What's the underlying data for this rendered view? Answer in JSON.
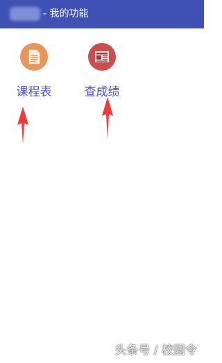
{
  "appbar": {
    "title": "- 我的功能",
    "background": "#3f51b5"
  },
  "features": [
    {
      "label": "课程表",
      "icon": "document-icon",
      "icon_bg": "#e8965a"
    },
    {
      "label": "查成绩",
      "icon": "newspaper-icon",
      "icon_bg": "#c94f4f"
    }
  ],
  "annotation": {
    "arrow_color": "#f03a3a"
  },
  "watermark": {
    "text": "头条号 / 校园令"
  }
}
